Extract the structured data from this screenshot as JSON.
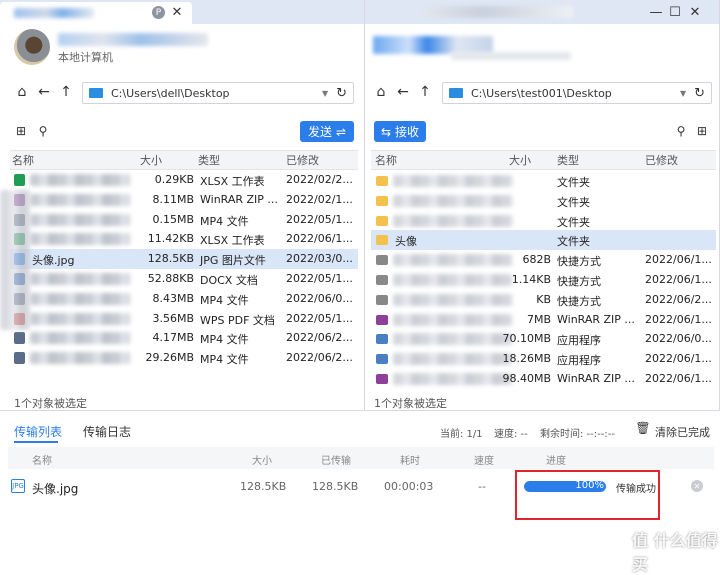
{
  "left": {
    "subtitle": "本地计算机",
    "path": "C:\\Users\\dell\\Desktop",
    "send_label": "发送",
    "columns": [
      "名称",
      "大小",
      "类型",
      "已修改"
    ],
    "files": [
      {
        "name": "",
        "size": "0.29KB",
        "type": "XLSX 工作表",
        "date": "2022/02/2..."
      },
      {
        "name": "",
        "size": "8.11MB",
        "type": "WinRAR ZIP ...",
        "date": "2022/02/1..."
      },
      {
        "name": "",
        "size": "0.15MB",
        "type": "MP4 文件",
        "date": "2022/05/1..."
      },
      {
        "name": "",
        "size": "11.42KB",
        "type": "XLSX 工作表",
        "date": "2022/06/1..."
      },
      {
        "name": "头像.jpg",
        "size": "128.5KB",
        "type": "JPG 图片文件",
        "date": "2022/03/0..."
      },
      {
        "name": "",
        "size": "52.88KB",
        "type": "DOCX 文档",
        "date": "2022/05/1..."
      },
      {
        "name": "",
        "size": "8.43MB",
        "type": "MP4 文件",
        "date": "2022/06/0..."
      },
      {
        "name": "",
        "size": "3.56MB",
        "type": "WPS PDF 文档",
        "date": "2022/05/1..."
      },
      {
        "name": "",
        "size": "4.17MB",
        "type": "MP4 文件",
        "date": "2022/06/2..."
      },
      {
        "name": "",
        "size": "29.26MB",
        "type": "MP4 文件",
        "date": "2022/06/2..."
      }
    ],
    "status": "1个对象被选定"
  },
  "right": {
    "path": "C:\\Users\\test001\\Desktop",
    "receive_label": "接收",
    "columns": [
      "名称",
      "大小",
      "类型",
      "已修改"
    ],
    "files": [
      {
        "name": "",
        "size": "",
        "type": "文件夹",
        "date": ""
      },
      {
        "name": "",
        "size": "",
        "type": "文件夹",
        "date": ""
      },
      {
        "name": "",
        "size": "",
        "type": "文件夹",
        "date": ""
      },
      {
        "name": "头像",
        "size": "",
        "type": "文件夹",
        "date": ""
      },
      {
        "name": "",
        "size": "682B",
        "type": "快捷方式",
        "date": "2022/06/1..."
      },
      {
        "name": "",
        "size": "1.14KB",
        "type": "快捷方式",
        "date": "2022/06/1..."
      },
      {
        "name": "",
        "size": "KB",
        "type": "快捷方式",
        "date": "2022/06/2..."
      },
      {
        "name": "",
        "size": "7MB",
        "type": "WinRAR ZIP ...",
        "date": "2022/06/1..."
      },
      {
        "name": "",
        "size": "70.10MB",
        "type": "应用程序",
        "date": "2022/06/0..."
      },
      {
        "name": "",
        "size": "18.26MB",
        "type": "应用程序",
        "date": "2022/06/1..."
      },
      {
        "name": "",
        "size": "98.40MB",
        "type": "WinRAR ZIP ...",
        "date": "2022/06/1..."
      }
    ],
    "status": "1个对象被选定"
  },
  "transfer": {
    "tab_list": "传输列表",
    "tab_log": "传输日志",
    "current": "当前: 1/1",
    "speed": "速度: --",
    "remaining": "剩余时间: --:--:--",
    "clear_label": "清除已完成",
    "columns": [
      "名称",
      "大小",
      "已传输",
      "耗时",
      "速度",
      "进度"
    ],
    "item": {
      "name": "头像.jpg",
      "size": "128.5KB",
      "transferred": "128.5KB",
      "elapsed": "00:00:03",
      "speed": "--",
      "progress_text": "100%",
      "progress": 1.0,
      "result": "传输成功"
    }
  },
  "watermark": "值 什么值得买",
  "colors": {
    "accent": "#2b7de9",
    "selected": "#d9e6f8",
    "highlight_box": "#e0252b"
  }
}
